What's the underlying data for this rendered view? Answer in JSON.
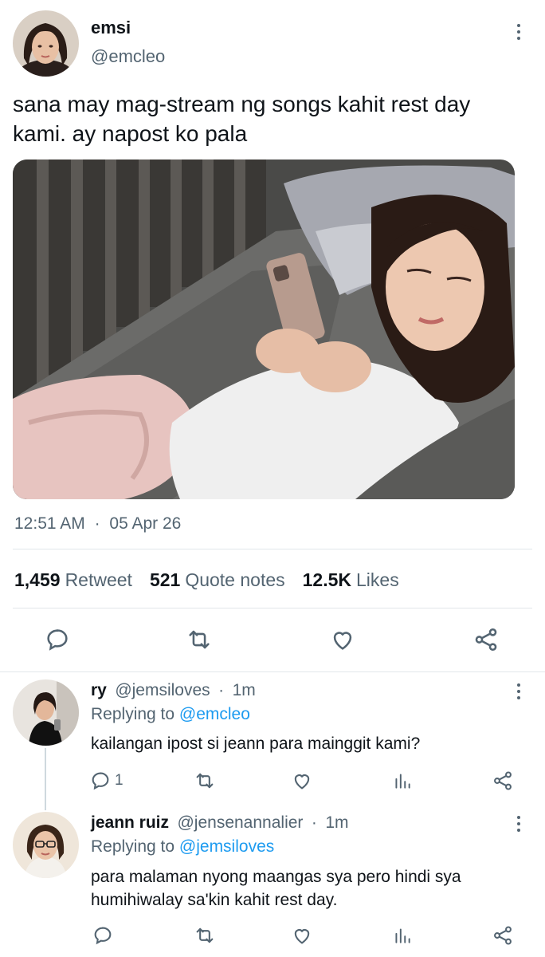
{
  "main_tweet": {
    "name": "emsi",
    "handle": "@emcleo",
    "text_line1": "sana may mag-stream ng songs kahit rest day",
    "text_line2": "kami. ay napost ko pala",
    "time": "12:51 AM",
    "date": "05 Apr 26",
    "time_sep": "·",
    "stats": {
      "retweets_count": "1,459",
      "retweets_label": "Retweet",
      "quotes_count": "521",
      "quotes_label": "Quote notes",
      "likes_count": "12.5K",
      "likes_label": "Likes"
    }
  },
  "replies": [
    {
      "name": "ry",
      "handle": "@jemsiloves",
      "sep": "·",
      "time": "1m",
      "replying_label": "Replying to",
      "replying_to": "@emcleo",
      "text_line1": "kailangan ipost si jeann para mainggit kami?",
      "text_line2": "",
      "reply_count": "1"
    },
    {
      "name": "jeann ruiz",
      "handle": "@jensenannalier",
      "sep": "·",
      "time": "1m",
      "replying_label": "Replying to",
      "replying_to": "@jemsiloves",
      "text_line1": "para malaman nyong maangas sya pero hindi sya",
      "text_line2": "humihiwalay sa'kin kahit rest day.",
      "reply_count": ""
    }
  ],
  "icons": [
    "reply-icon",
    "retweet-icon",
    "like-icon",
    "share-icon",
    "analytics-icon",
    "more-icon"
  ],
  "colors": {
    "text": "#0f1419",
    "secondary": "#536471",
    "link": "#1d9bf0",
    "divider": "#e1e6ea"
  }
}
